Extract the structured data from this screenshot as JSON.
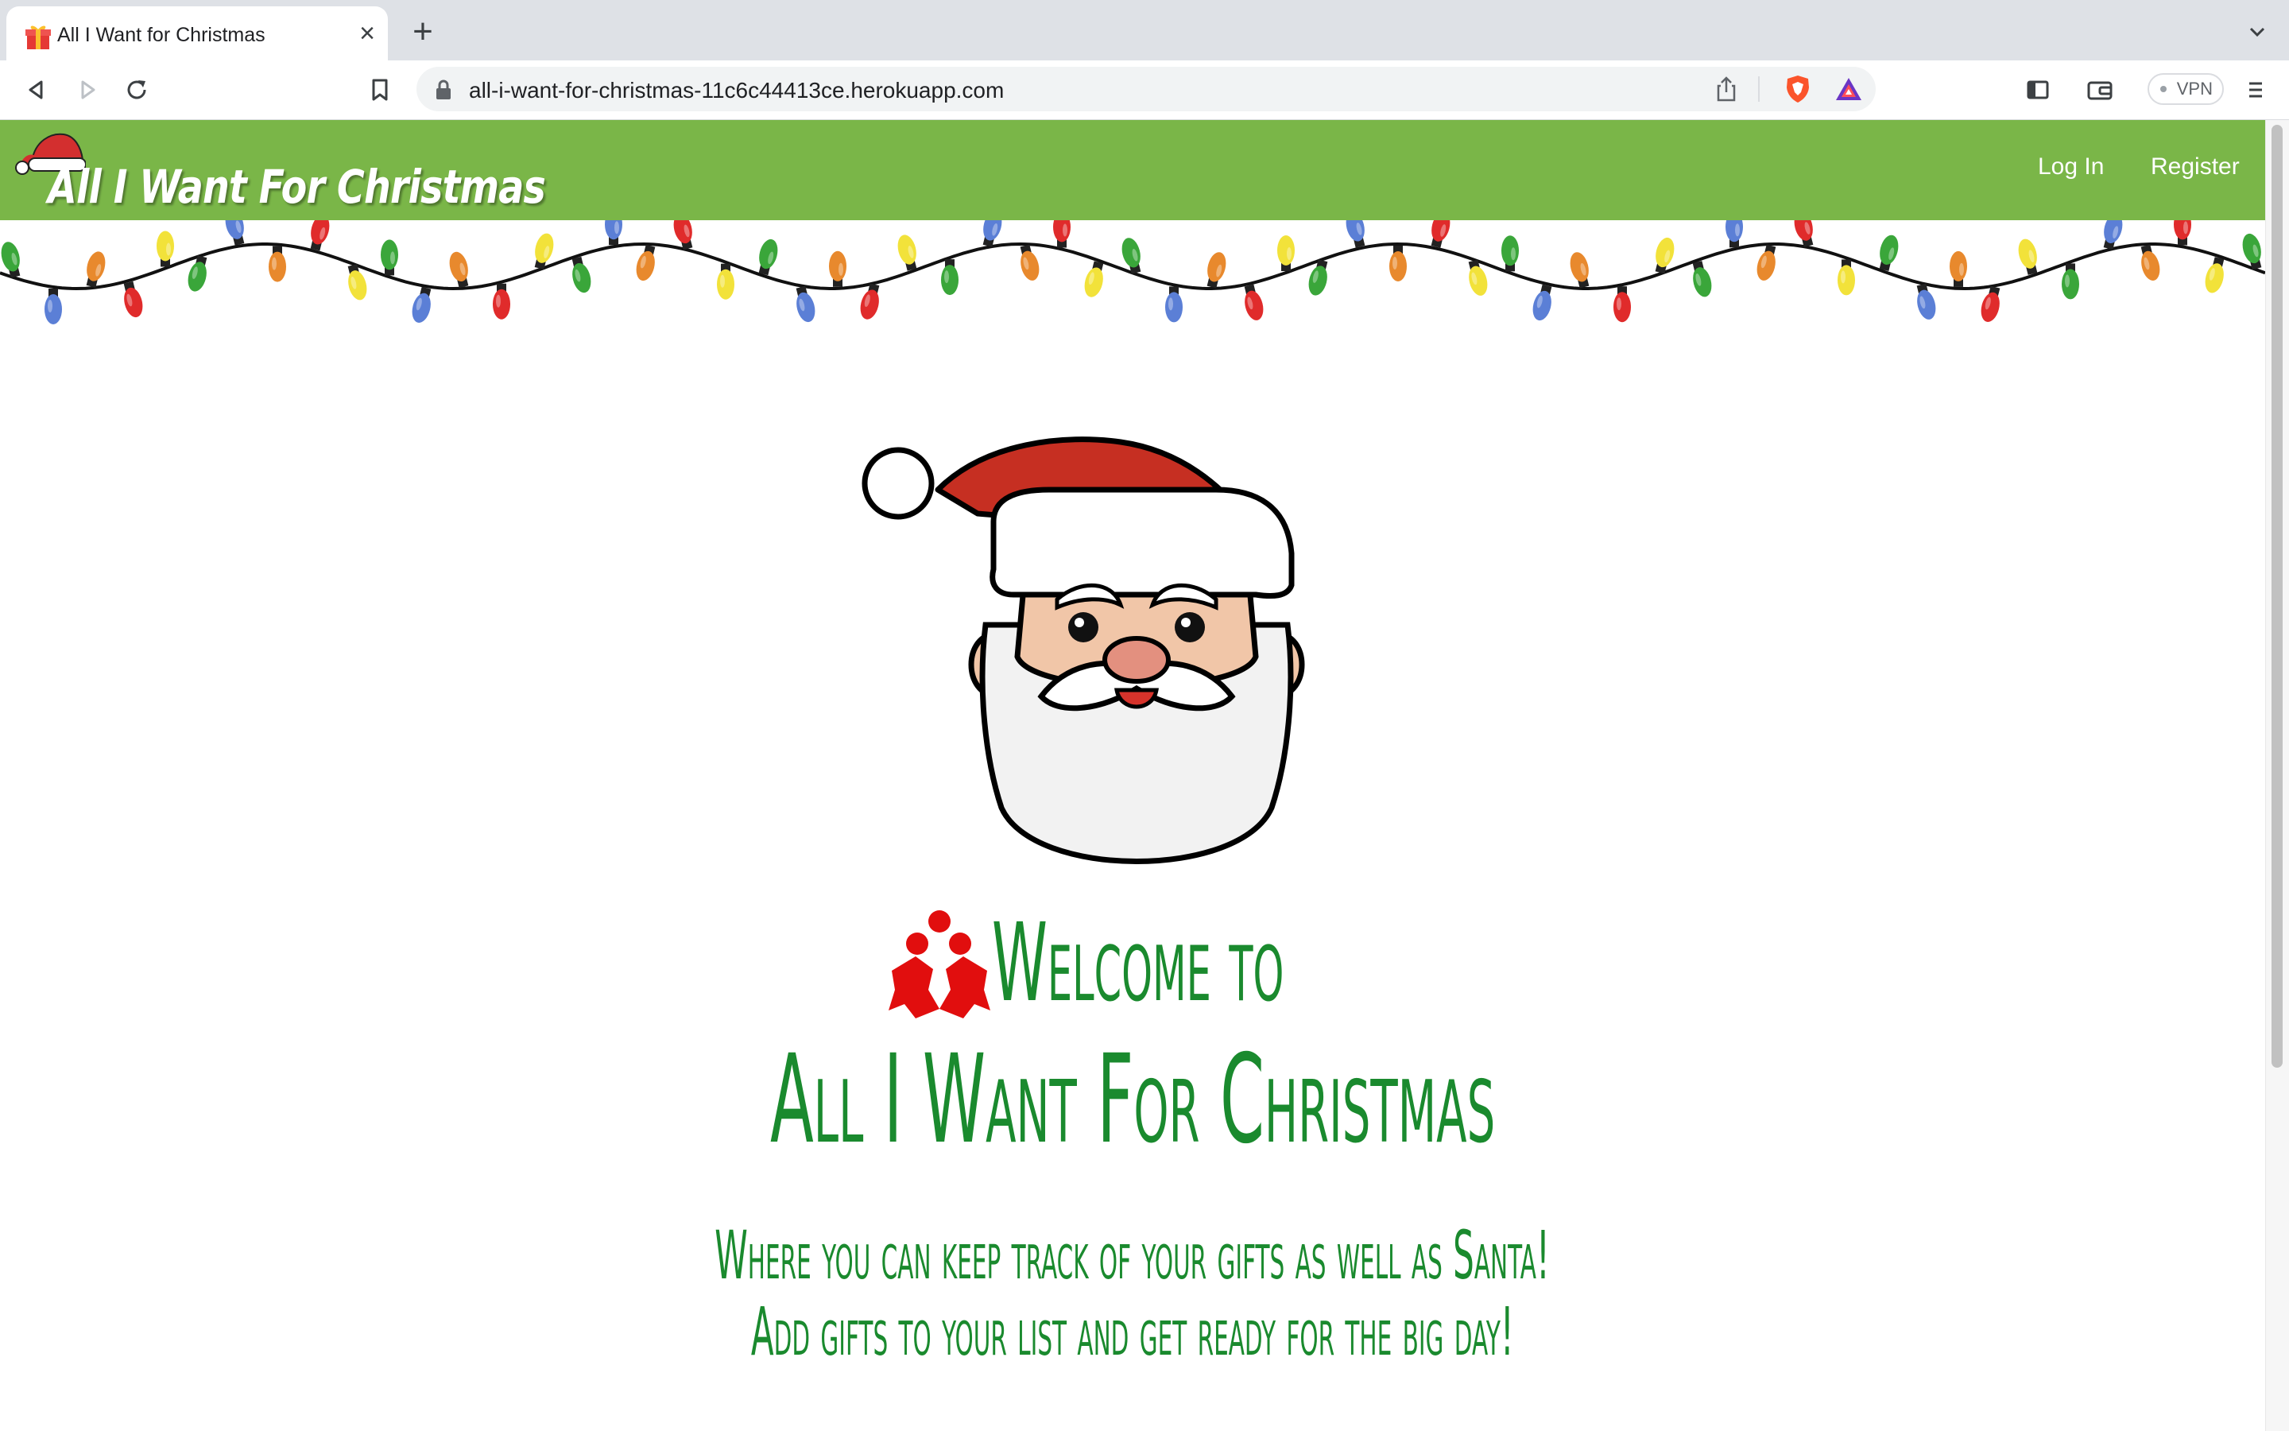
{
  "browser": {
    "tab_title": "All I Want for Christmas",
    "tab_close": "×",
    "new_tab": "+",
    "url": "all-i-want-for-christmas-11c6c44413ce.herokuapp.com",
    "vpn_label": "VPN"
  },
  "navbar": {
    "brand": "All I Want For Christmas",
    "login": "Log In",
    "register": "Register",
    "color": "#7ab648"
  },
  "hero": {
    "welcome": "Welcome to",
    "title": "All I Want For Christmas",
    "tagline_1": "Where you can keep track of your gifts as well as Santa!",
    "tagline_2": "Add gifts to your list and get ready for the big day!",
    "text_color": "#1a8a2e"
  },
  "icons": [
    "gift-favicon-icon",
    "back-icon",
    "forward-icon",
    "reload-icon",
    "bookmark-icon",
    "lock-icon",
    "share-icon",
    "brave-shield-icon",
    "brave-rewards-icon",
    "sidebar-icon",
    "wallet-icon",
    "menu-icon",
    "santa-hat-icon",
    "christmas-lights",
    "santa-face-illustration",
    "holly-icon"
  ]
}
